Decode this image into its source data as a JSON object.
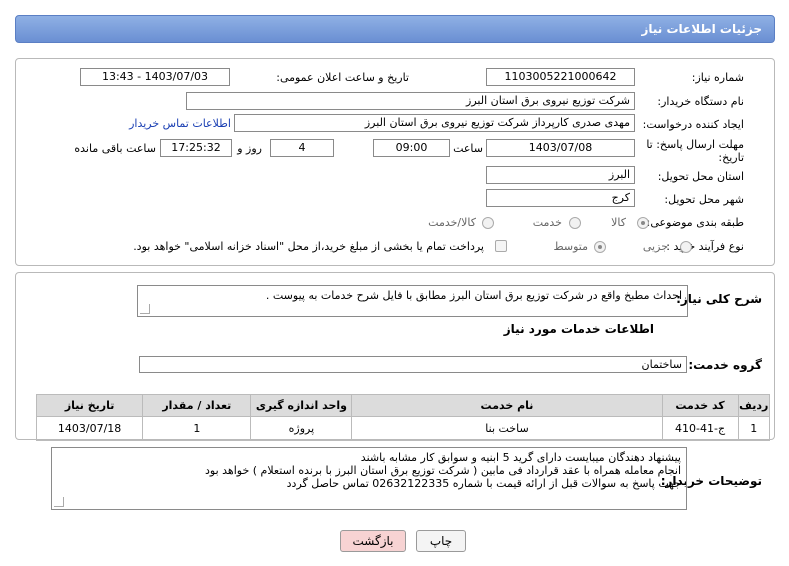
{
  "header": {
    "title": "جزئیات اطلاعات نیاز"
  },
  "form": {
    "need_number_label": "شماره نیاز:",
    "need_number": "1103005221000642",
    "announce_label": "تاریخ و ساعت اعلان عمومی:",
    "announce_value": "1403/07/03 - 13:43",
    "buyer_org_label": "نام دستگاه خریدار:",
    "buyer_org": "شرکت توزیع نیروی برق استان البرز",
    "creator_label": "ایجاد کننده درخواست:",
    "creator": "مهدی صدری کارپرداز شرکت توزیع نیروی برق استان البرز",
    "contact_link": "اطلاعات تماس خریدار",
    "deadline_label": "مهلت ارسال پاسخ: تا تاریخ:",
    "deadline_date": "1403/07/08",
    "time_label": "ساعت",
    "deadline_time": "09:00",
    "days_value": "4",
    "days_label": "روز و",
    "remaining_time": "17:25:32",
    "remaining_label": "ساعت باقی مانده",
    "province_label": "استان محل تحویل:",
    "province": "البرز",
    "city_label": "شهر محل تحویل:",
    "city": "کرج",
    "category_label": "طبقه بندی موضوعی:",
    "category_options": [
      "کالا",
      "خدمت",
      "کالا/خدمت"
    ],
    "process_label": "نوع فرآیند خرید :",
    "process_options": [
      "جزیی",
      "متوسط"
    ],
    "payment_note": "پرداخت تمام یا بخشی از مبلغ خرید،از محل \"اسناد خزانه اسلامی\" خواهد بود."
  },
  "summary": {
    "label": "شرح کلی نیاز:",
    "text": "احداث مطبخ واقع در شرکت توزیع برق استان البرز مطابق با فایل شرح خدمات به پیوست ."
  },
  "services": {
    "section_title": "اطلاعات خدمات مورد نیاز",
    "group_label": "گروه خدمت:",
    "group_value": "ساختمان",
    "columns": [
      "ردیف",
      "کد خدمت",
      "نام خدمت",
      "واحد اندازه گیری",
      "تعداد / مقدار",
      "تاریخ نیاز"
    ],
    "rows": [
      [
        "1",
        "ج-41-410",
        "ساخت بنا",
        "پروژه",
        "1",
        "1403/07/18"
      ]
    ]
  },
  "buyer_notes": {
    "label": "توضیحات خریدار:",
    "lines": [
      "پیشنهاد دهندگان میبایست دارای گرید 5 ابنیه و سوابق کار مشابه باشند",
      "انجام معامله همراه با عقد قرارداد فی مابین ( شرکت توزیع برق استان البرز با برنده استعلام ) خواهد بود",
      "جهت پاسخ به سوالات قبل از ارائه قیمت با شماره 02632122335 تماس حاصل گردد"
    ]
  },
  "buttons": {
    "print": "چاپ",
    "back": "بازگشت"
  },
  "colors": {
    "title_bar": "#7396d8",
    "back_button": "#f7d3d3",
    "link": "#1a3fb3"
  }
}
